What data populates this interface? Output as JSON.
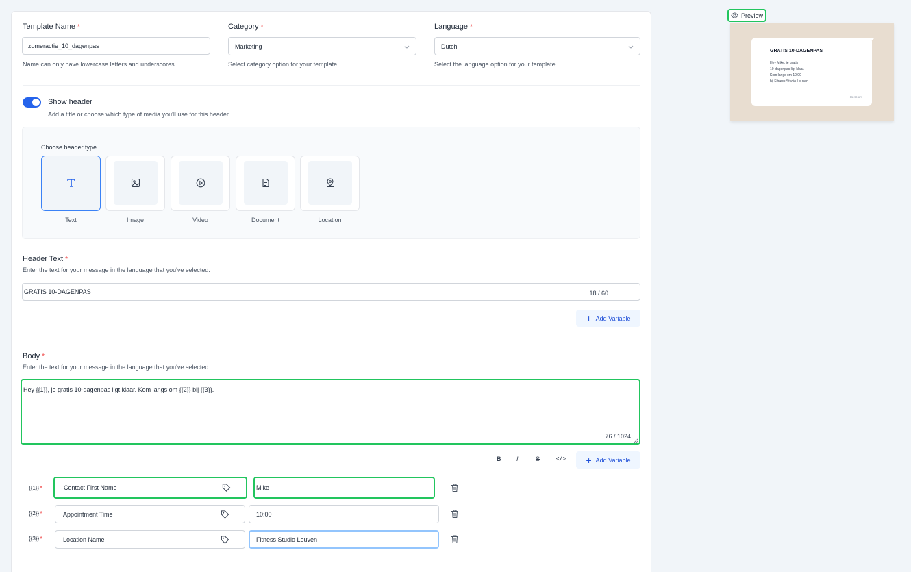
{
  "template_name": {
    "label": "Template Name",
    "required_mark": "*",
    "value": "zomeractie_10_dagenpas",
    "help": "Name can only have lowercase letters and underscores."
  },
  "category": {
    "label": "Category",
    "required_mark": "*",
    "value": "Marketing",
    "help": "Select category option for your template."
  },
  "language": {
    "label": "Language",
    "required_mark": "*",
    "value": "Dutch",
    "help": "Select the language option for your template."
  },
  "show_header": {
    "label": "Show header",
    "help": "Add a title or choose which type of media you'll use for this header.",
    "enabled": true
  },
  "header_type": {
    "label": "Choose header type",
    "options": [
      "Text",
      "Image",
      "Video",
      "Document",
      "Location"
    ],
    "selected": "Text"
  },
  "header_text": {
    "label": "Header Text",
    "required_mark": "*",
    "help": "Enter the text for your message in the language that you've selected.",
    "value": "GRATIS 10-DAGENPAS",
    "count": "18 / 60",
    "add_variable": "Add Variable"
  },
  "body": {
    "label": "Body",
    "required_mark": "*",
    "help": "Enter the text for your message in the language that you've selected.",
    "value": "Hey {{1}}, je gratis 10-dagenpas ligt klaar. Kom langs om {{2}} bij {{3}}.",
    "count": "76 / 1024",
    "format_buttons": [
      "B",
      "I",
      "S",
      "</>"
    ],
    "add_variable": "Add Variable"
  },
  "variables": [
    {
      "tag": "{{1}}",
      "required_mark": "*",
      "field": "Contact First Name",
      "sample": "Mike"
    },
    {
      "tag": "{{2}}",
      "required_mark": "*",
      "field": "Appointment Time",
      "sample": "10:00"
    },
    {
      "tag": "{{3}}",
      "required_mark": "*",
      "field": "Location Name",
      "sample": "Fitness Studio Leuven"
    }
  ],
  "preview": {
    "button_label": "Preview",
    "title": "GRATIS 10-DAGENPAS",
    "body": "Hey Mike, je gratis\n10-dagenpas ligt klaar.\nKom langs om 10:00\nbij Fitness Studio Leuven.",
    "time": "11:46 am"
  },
  "colors": {
    "accent": "#2563eb",
    "focus_green": "#22c55e",
    "required": "#ef4444"
  }
}
